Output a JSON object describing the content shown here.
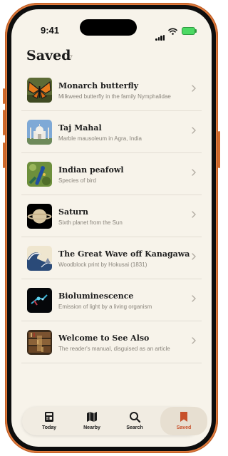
{
  "status": {
    "time": "9:41"
  },
  "header": {
    "title": "Saved",
    "count": "7"
  },
  "items": [
    {
      "title": "Monarch butterfly",
      "subtitle": "Milkweed butterfly in the family Nymphalidae",
      "thumb_icon": "butterfly-thumbnail"
    },
    {
      "title": "Taj Mahal",
      "subtitle": "Marble mausoleum in Agra, India",
      "thumb_icon": "taj-mahal-thumbnail"
    },
    {
      "title": "Indian peafowl",
      "subtitle": "Species of bird",
      "thumb_icon": "peafowl-thumbnail"
    },
    {
      "title": "Saturn",
      "subtitle": "Sixth planet from the Sun",
      "thumb_icon": "saturn-thumbnail"
    },
    {
      "title": "The Great Wave off Kanagawa",
      "subtitle": "Woodblock print by Hokusai (1831)",
      "thumb_icon": "great-wave-thumbnail"
    },
    {
      "title": "Bioluminescence",
      "subtitle": "Emission of light by a living organism",
      "thumb_icon": "bioluminescence-thumbnail"
    },
    {
      "title": "Welcome to See Also",
      "subtitle": "The reader's manual, disguised as an article",
      "thumb_icon": "library-thumbnail"
    }
  ],
  "tabs": [
    {
      "label": "Today",
      "icon": "newspaper-icon",
      "active": false
    },
    {
      "label": "Nearby",
      "icon": "map-icon",
      "active": false
    },
    {
      "label": "Search",
      "icon": "search-icon",
      "active": false
    },
    {
      "label": "Saved",
      "icon": "bookmark-icon",
      "active": true
    }
  ],
  "colors": {
    "accent": "#c7502a",
    "background": "#f7f3ea",
    "frame": "#e07a3c"
  }
}
